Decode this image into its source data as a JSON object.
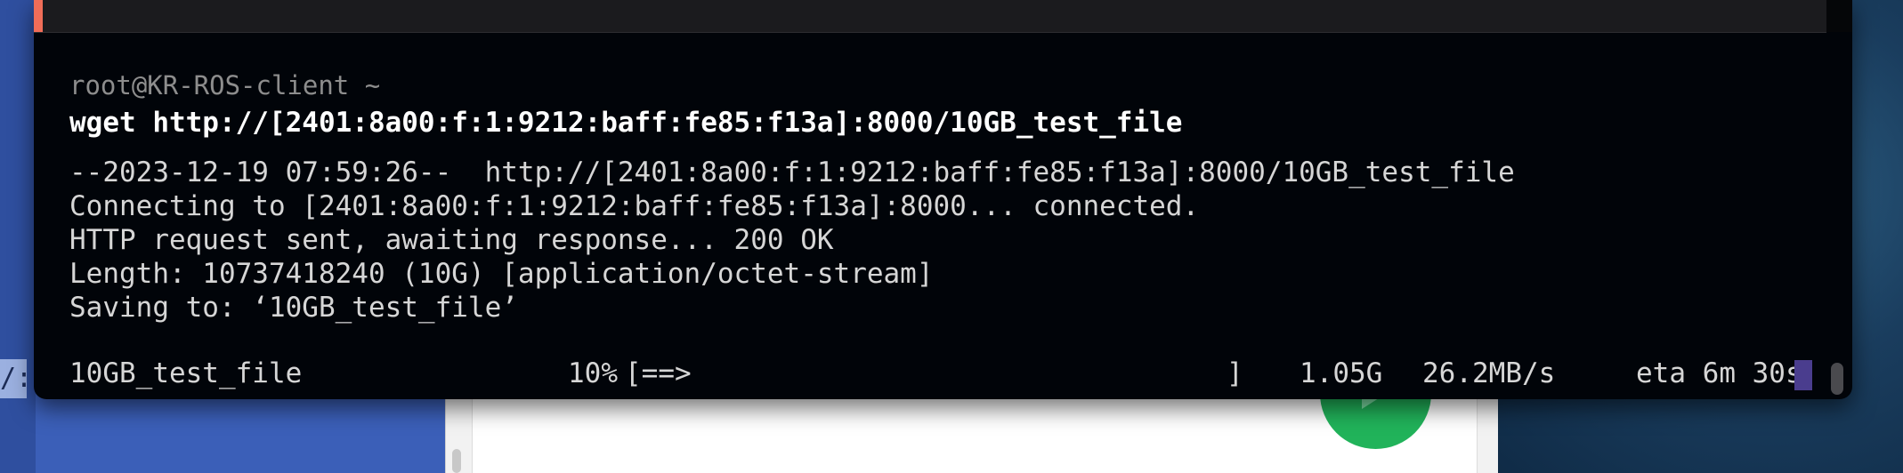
{
  "desktop": {
    "left_snippet": "/:",
    "colors": {
      "terminal_bg": "#010409",
      "desktop_blue": "#3b5fb8",
      "accent_green": "#21b35a",
      "cursor": "#4a3d8e",
      "tab_accent": "#f06d58"
    }
  },
  "terminal": {
    "prompt": "root@KR-ROS-client ~",
    "command": "wget http://[2401:8a00:f:1:9212:baff:fe85:f13a]:8000/10GB_test_file",
    "output": [
      "--2023-12-19 07:59:26--  http://[2401:8a00:f:1:9212:baff:fe85:f13a]:8000/10GB_test_file",
      "Connecting to [2401:8a00:f:1:9212:baff:fe85:f13a]:8000... connected.",
      "HTTP request sent, awaiting response... 200 OK",
      "Length: 10737418240 (10G) [application/octet-stream]",
      "Saving to: ‘10GB_test_file’"
    ],
    "progress": {
      "filename": "10GB_test_file",
      "percent": "10%",
      "bar": "[==>",
      "bar_close": "]",
      "downloaded": "1.05G",
      "rate": "26.2MB/s",
      "eta": "eta 6m 30s",
      "fraction": 0.1
    }
  }
}
